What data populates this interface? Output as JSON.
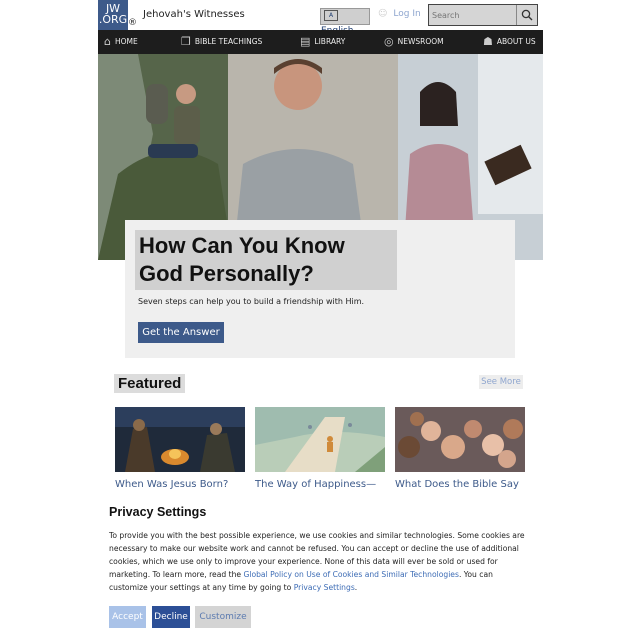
{
  "header": {
    "logo_line1": "JW",
    "logo_line2": ".ORG",
    "logo_reg": "®",
    "site_name": "Jehovah's Witnesses",
    "language_label": "English",
    "login_label": "Log In",
    "search_placeholder": "Search"
  },
  "nav": {
    "items": [
      {
        "label": "HOME",
        "icon": "home-icon"
      },
      {
        "label": "BIBLE TEACHINGS",
        "icon": "bible-icon"
      },
      {
        "label": "LIBRARY",
        "icon": "library-icon"
      },
      {
        "label": "NEWSROOM",
        "icon": "globe-icon"
      },
      {
        "label": "ABOUT US",
        "icon": "people-icon"
      }
    ]
  },
  "hero": {
    "title": "How Can You Know God Personally?",
    "subtitle": "Seven steps can help you to build a friendship with Him.",
    "button_label": "Get the Answer"
  },
  "featured": {
    "title": "Featured",
    "see_more": "See More",
    "items": [
      {
        "caption": "When Was Jesus Born?"
      },
      {
        "caption": "The Way of Happiness—"
      },
      {
        "caption": "What Does the Bible Say"
      }
    ]
  },
  "privacy": {
    "title": "Privacy Settings",
    "text_part1": "To provide you with the best possible experience, we use cookies and similar technologies. Some cookies are necessary to make our website work and cannot be refused. You can accept or decline the use of additional cookies, which we use only to improve your experience. None of this data will ever be sold or used for marketing. To learn more, read the ",
    "policy_link": "Global Policy on Use of Cookies and Similar Technologies",
    "text_part2": ". You can customize your settings at any time by going to ",
    "settings_link": "Privacy Settings",
    "text_part3": ".",
    "accept_label": "Accept",
    "decline_label": "Decline",
    "customize_label": "Customize"
  },
  "colors": {
    "brand_blue": "#3d5a8a",
    "nav_bg": "#1d1d1d",
    "link_blue": "#3d6cb5",
    "decline_bg": "#2c4f96",
    "accept_bg": "#a9c2e8"
  }
}
